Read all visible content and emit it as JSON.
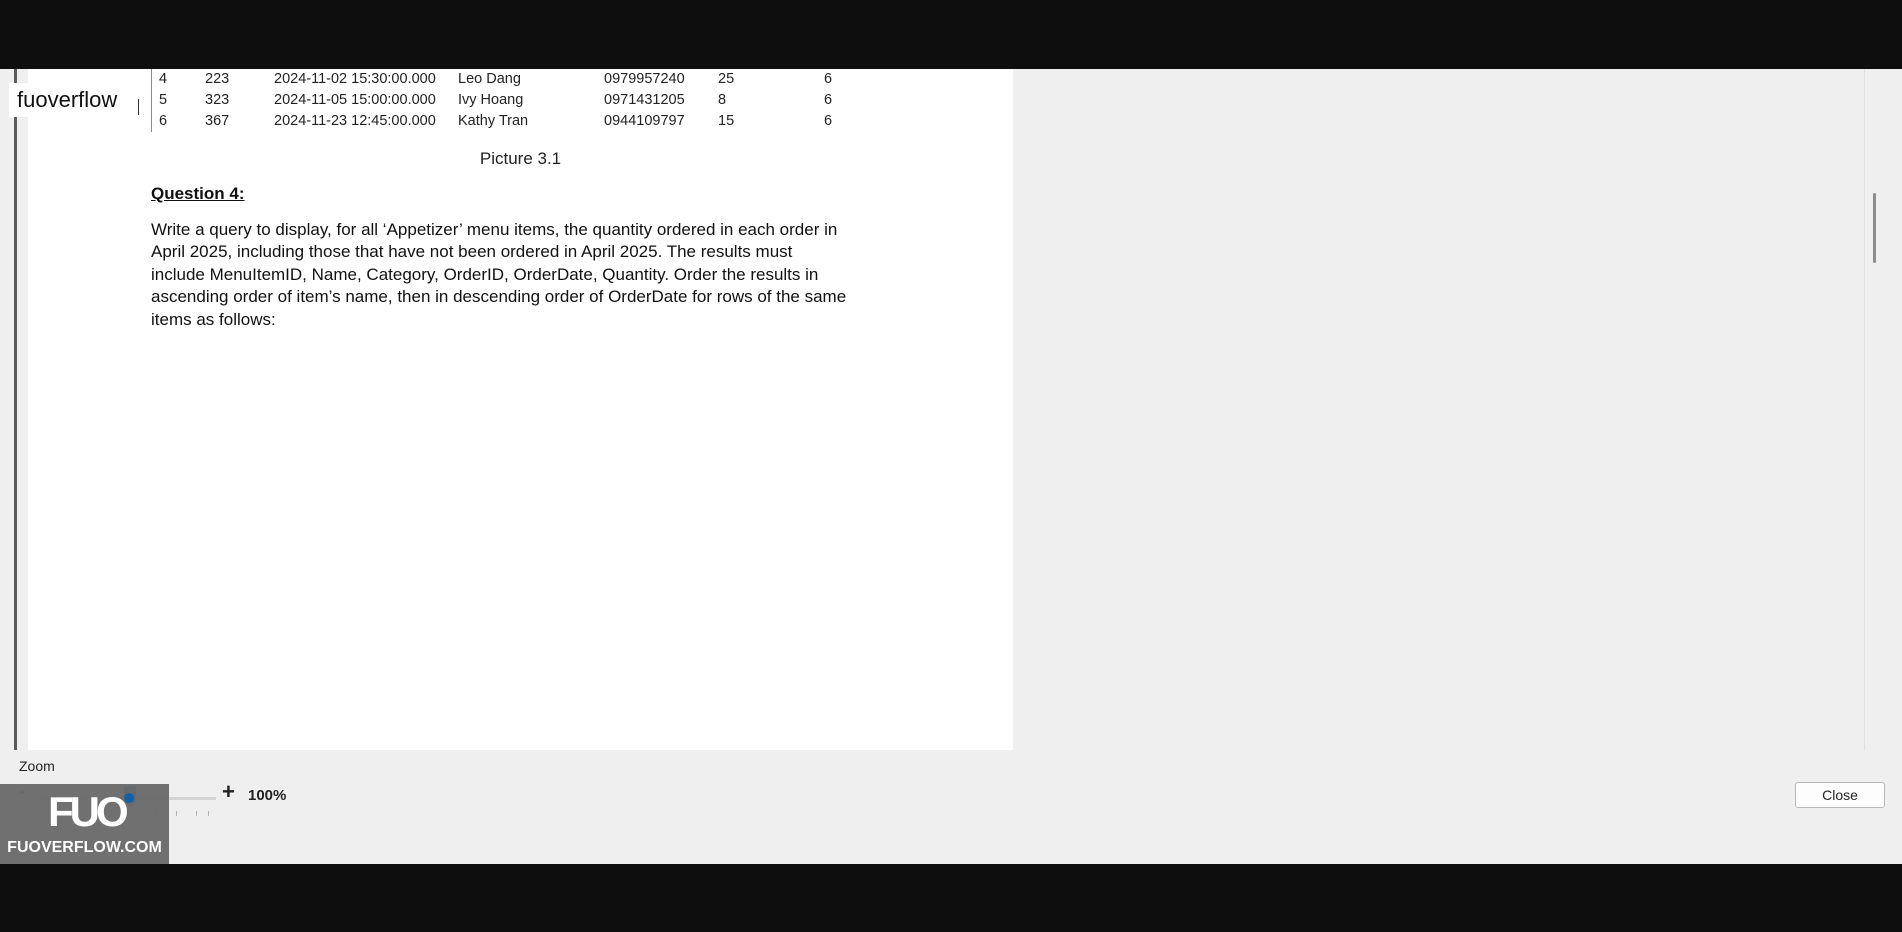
{
  "overlay": {
    "app_label": "fuoverflow"
  },
  "document": {
    "table_rows": [
      [
        "4",
        "223",
        "2024-11-02 15:30:00.000",
        "Leo Dang",
        "0979957240",
        "25",
        "6"
      ],
      [
        "5",
        "323",
        "2024-11-05 15:00:00.000",
        "Ivy Hoang",
        "0971431205",
        "8",
        "6"
      ],
      [
        "6",
        "367",
        "2024-11-23 12:45:00.000",
        "Kathy Tran",
        "0944109797",
        "15",
        "6"
      ]
    ],
    "caption": "Picture 3.1",
    "question_heading": "Question 4:",
    "question_lines": [
      "Write a query to display, for all ‘Appetizer’ menu items, the quantity ordered in each order in",
      "April 2025, including those that have not been ordered in April 2025. The results must",
      "include MenuItemID, Name, Category, OrderID, OrderDate, Quantity. Order the results in",
      "ascending order of item’s name, then in descending order of OrderDate for rows of the same",
      "items as follows:"
    ]
  },
  "zoom": {
    "label": "Zoom",
    "minus": "-",
    "plus": "+",
    "value": "100%",
    "level_percent": 100
  },
  "watermark": {
    "logo": "FUO",
    "text": "FUOVERFLOW.COM"
  },
  "footer": {
    "close_label": "Close"
  },
  "colors": {
    "accent": "#0a56a2",
    "background": "#efefef",
    "page": "#ffffff"
  }
}
